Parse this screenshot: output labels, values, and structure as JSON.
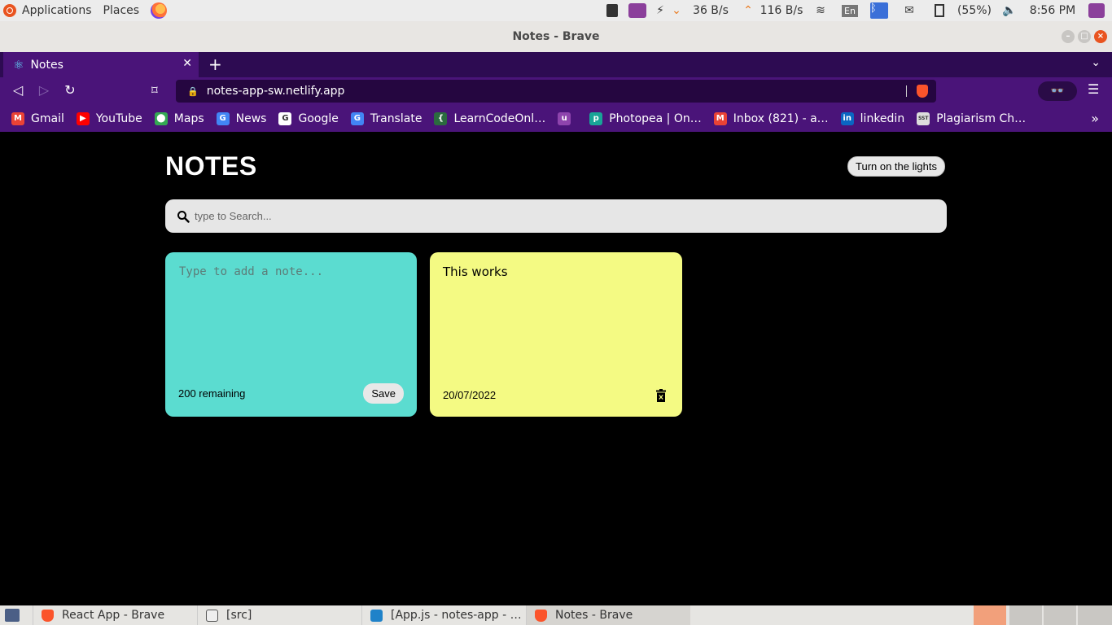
{
  "top_panel": {
    "applications": "Applications",
    "places": "Places",
    "net_down": "36 B/s",
    "net_up": "116 B/s",
    "keyboard": "En",
    "battery": "(55%)",
    "clock": "8:56 PM"
  },
  "window": {
    "title": "Notes - Brave"
  },
  "browser": {
    "tab_title": "Notes",
    "url": "notes-app-sw.netlify.app",
    "bookmarks": [
      {
        "label": "Gmail",
        "color": "#ea4335",
        "glyph": "M"
      },
      {
        "label": "YouTube",
        "color": "#ff0000",
        "glyph": "▶"
      },
      {
        "label": "Maps",
        "color": "#34a853",
        "glyph": "⬤"
      },
      {
        "label": "News",
        "color": "#4285f4",
        "glyph": "G"
      },
      {
        "label": "Google",
        "color": "#ffffff",
        "glyph": "G"
      },
      {
        "label": "Translate",
        "color": "#4285f4",
        "glyph": "G"
      },
      {
        "label": "LearnCodeOnl…",
        "color": "#2b6b3f",
        "glyph": "{"
      },
      {
        "label": "",
        "color": "#8e44ad",
        "glyph": "u"
      },
      {
        "label": "Photopea | On…",
        "color": "#18a497",
        "glyph": "p"
      },
      {
        "label": "Inbox (821) - a…",
        "color": "#ea4335",
        "glyph": "M"
      },
      {
        "label": "linkedin",
        "color": "#0a66c2",
        "glyph": "in"
      },
      {
        "label": "Plagiarism Ch…",
        "color": "#dddddd",
        "glyph": "SST"
      }
    ]
  },
  "app": {
    "title": "NOTES",
    "theme_button": "Turn on the lights",
    "search_placeholder": "type to Search...",
    "new_note": {
      "placeholder": "Type to add a note...",
      "remaining": "200 remaining",
      "save_label": "Save",
      "color": "#5bdcd0"
    },
    "notes": [
      {
        "text": "This works",
        "date": "20/07/2022",
        "color": "#f4fa83"
      }
    ]
  },
  "taskbar": {
    "tasks": [
      {
        "label": "React App - Brave",
        "icon": "brave-icon"
      },
      {
        "label": "[src]",
        "icon": "folder-icon"
      },
      {
        "label": "[App.js - notes-app - …",
        "icon": "vscode-icon"
      },
      {
        "label": "Notes - Brave",
        "icon": "brave-icon"
      }
    ]
  }
}
